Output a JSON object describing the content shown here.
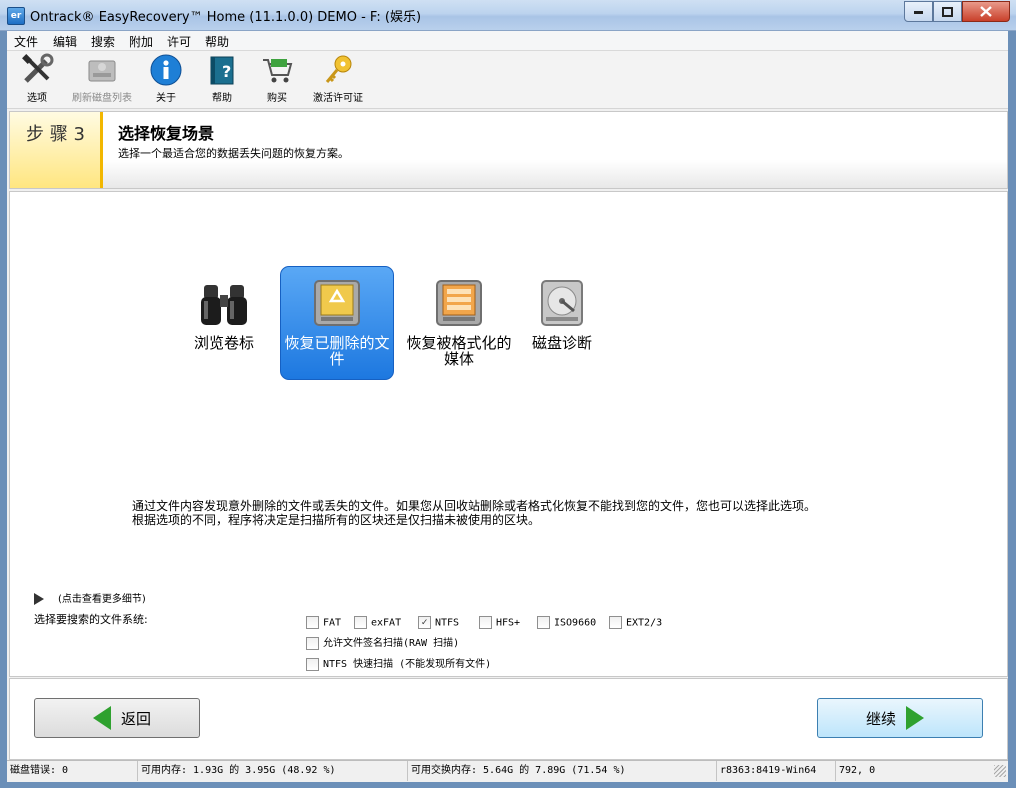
{
  "window": {
    "title": "Ontrack® EasyRecovery™ Home (11.1.0.0) DEMO - F: (娱乐)",
    "app_icon_text": "er"
  },
  "menu": [
    "文件",
    "编辑",
    "搜索",
    "附加",
    "许可",
    "帮助"
  ],
  "toolbar": [
    {
      "label": "选项",
      "icon": "tools-icon",
      "enabled": true
    },
    {
      "label": "刷新磁盘列表",
      "icon": "refresh-disk-icon",
      "enabled": false
    },
    {
      "label": "关于",
      "icon": "info-icon",
      "enabled": true
    },
    {
      "label": "帮助",
      "icon": "help-book-icon",
      "enabled": true
    },
    {
      "label": "购买",
      "icon": "cart-icon",
      "enabled": true
    },
    {
      "label": "激活许可证",
      "icon": "key-icon",
      "enabled": true
    }
  ],
  "step": {
    "label": "步 骤  3",
    "title": "选择恢复场景",
    "description": "选择一个最适合您的数据丢失问题的恢复方案。"
  },
  "options": [
    {
      "label": "浏览卷标",
      "icon": "binoculars-icon",
      "selected": false
    },
    {
      "label": "恢复已删除的文件",
      "icon": "recycle-drive-icon",
      "selected": true
    },
    {
      "label": "恢复被格式化的媒体",
      "icon": "formatted-drive-icon",
      "selected": false
    },
    {
      "label": "磁盘诊断",
      "icon": "hard-disk-icon",
      "selected": false
    }
  ],
  "info": {
    "line1": "通过文件内容发现意外删除的文件或丢失的文件。如果您从回收站删除或者格式化恢复不能找到您的文件，您也可以选择此选项。",
    "line2": "根据选项的不同，程序将决定是扫描所有的区块还是仅扫描未被使用的区块。"
  },
  "details_toggle": "(点击查看更多细节)",
  "filesystems": {
    "label": "选择要搜索的文件系统:",
    "items": [
      {
        "label": "FAT",
        "checked": false
      },
      {
        "label": "exFAT",
        "checked": false
      },
      {
        "label": "NTFS",
        "checked": true
      },
      {
        "label": "HFS+",
        "checked": false
      },
      {
        "label": "ISO9660",
        "checked": false
      },
      {
        "label": "EXT2/3",
        "checked": false
      }
    ],
    "raw_scan": "允许文件签名扫描(RAW 扫描)",
    "ntfs_quick": "NTFS 快速扫描 (不能发现所有文件)"
  },
  "buttons": {
    "back": "返回",
    "next": "继续"
  },
  "status": {
    "disk_errors": "磁盘错误: 0",
    "memory": "可用内存: 1.93G 的 3.95G (48.92 %)",
    "swap": "可用交换内存: 5.64G 的 7.89G (71.54 %)",
    "build": "r8363:8419-Win64",
    "coords": "792, 0"
  }
}
